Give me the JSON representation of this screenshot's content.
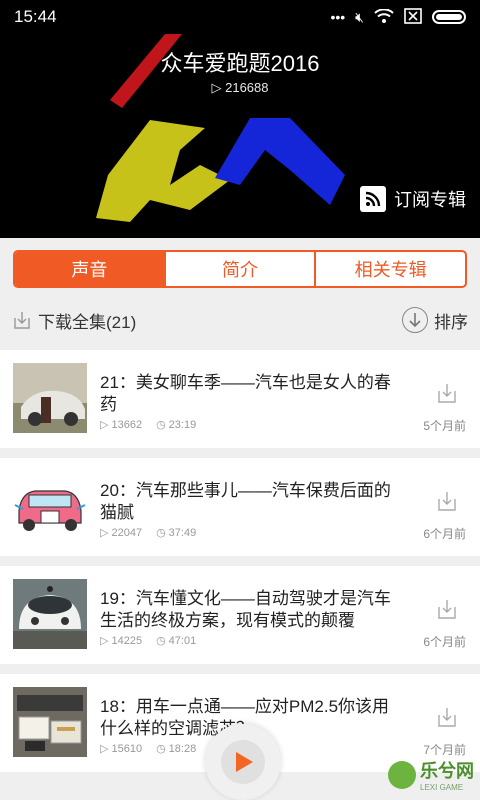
{
  "status_bar": {
    "time": "15:44"
  },
  "album": {
    "title": "众车爱跑题2016",
    "plays": "216688",
    "subscribe_label": "订阅专辑"
  },
  "tabs": [
    "声音",
    "简介",
    "相关专辑"
  ],
  "toolbar": {
    "download_all_label": "下载全集(21)",
    "sort_label": "排序"
  },
  "episodes": [
    {
      "title": "21：美女聊车季——汽车也是女人的春药",
      "plays": "13662",
      "duration": "23:19",
      "ago": "5个月前",
      "thumb_icon": "woman-car-photo"
    },
    {
      "title": "20：汽车那些事儿——汽车保费后面的猫腻",
      "plays": "22047",
      "duration": "37:49",
      "ago": "6个月前",
      "thumb_icon": "pink-car-cartoon"
    },
    {
      "title": "19：汽车懂文化——自动驾驶才是汽车生活的终极方案，现有模式的颠覆",
      "plays": "14225",
      "duration": "47:01",
      "ago": "6个月前",
      "thumb_icon": "self-driving-car-photo"
    },
    {
      "title": "18：用车一点通——应对PM2.5你该用什么样的空调滤芯？",
      "plays": "15610",
      "duration": "18:28",
      "ago": "7个月前",
      "thumb_icon": "air-filter-photo"
    }
  ],
  "watermark": {
    "text": "乐兮网",
    "sub": "LEXI GAME"
  }
}
